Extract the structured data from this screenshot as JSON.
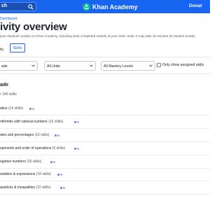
{
  "topbar": {
    "search_label": "ch",
    "brand": "Khan Academy",
    "donate": "Donat"
  },
  "header": {
    "breadcrumb": "Dashboard",
    "title": "ivity overview",
    "description": "your students' activity on Khan Academy, including work completed outside of your class. Note: It may take 10 minutes for student activity"
  },
  "tabs": {
    "partial_label": "ity",
    "skills_label": "Skills"
  },
  "filters": {
    "grade_label": "ade",
    "units_label": "All Units",
    "mastery_label": "All Mastery Levels",
    "only_assigned_label": "Only show assigned skills",
    "only_assigned_checked": false
  },
  "grade": {
    "title": "ade",
    "count_text": "• 146 skills"
  },
  "units": [
    {
      "name": "atios",
      "skills": "(14 skills)"
    },
    {
      "name": "rithmetic with rational numbers",
      "skills": "(16 skills)"
    },
    {
      "name": "ates and percentages",
      "skills": "(10 skills)"
    },
    {
      "name": "xponents and order of operations",
      "skills": "(6 skills)"
    },
    {
      "name": "egative numbers",
      "skills": "(16 skills)"
    },
    {
      "name": "ariables & expressions",
      "skills": "(18 skills)"
    },
    {
      "name": "quations & inequalities",
      "skills": "(22 skills)"
    }
  ],
  "colors": {
    "brand_blue": "#1865f2",
    "mastery_dot": "#8f6af0",
    "mastery_dot_light": "#b9a6f5"
  },
  "icons": [
    "search-icon",
    "khan-academy-logo-icon",
    "chevron-down-icon"
  ]
}
